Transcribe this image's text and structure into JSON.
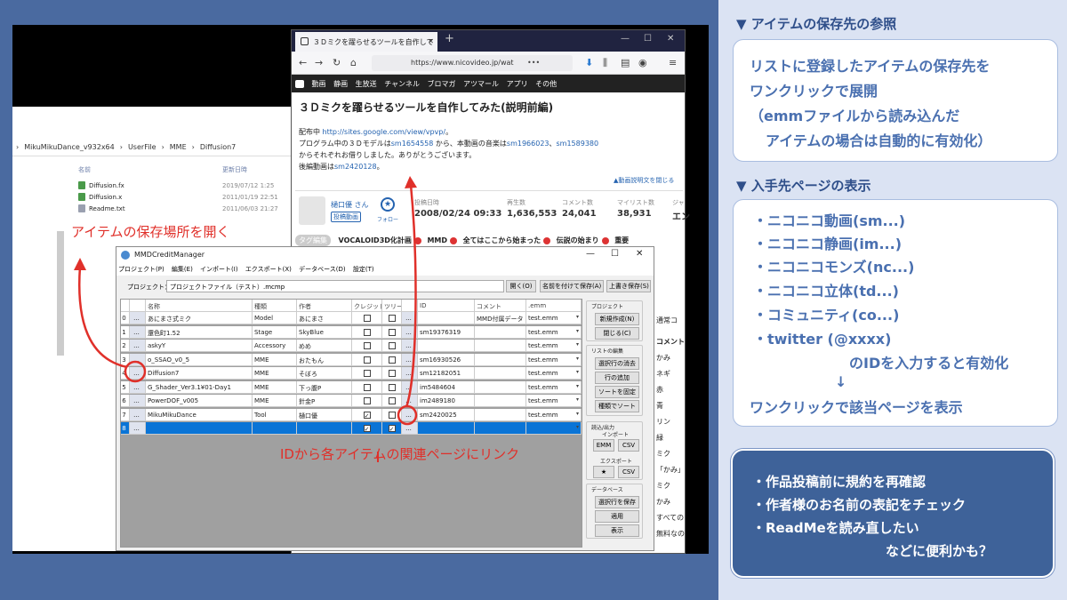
{
  "explorer": {
    "path": [
      "MikuMikuDance_v932x64",
      "UserFile",
      "MME",
      "Diffusion7"
    ],
    "col_name": "名前",
    "col_date": "更新日時",
    "files": [
      {
        "name": "Diffusion.fx",
        "date": "2019/07/12 1:25"
      },
      {
        "name": "Diffusion.x",
        "date": "2011/01/19 22:51"
      },
      {
        "name": "Readme.txt",
        "date": "2011/06/03 21:27"
      }
    ]
  },
  "annotations": {
    "open_location": "アイテムの保存場所を開く",
    "link_from_id": "IDから各アイテムの関連ページにリンク"
  },
  "browser": {
    "tab_title": "３Ｄミクを躍らせるツールを自作して",
    "tab_close": "✕",
    "new_tab": "+",
    "url": "https://www.nicovideo.jp/wat",
    "url_more": "•••",
    "nav_bar": [
      "動画",
      "静画",
      "生放送",
      "チャンネル",
      "ブロマガ",
      "アツマール",
      "アプリ",
      "その他"
    ],
    "video_title": "３Ｄミクを躍らせるツールを自作してみた(説明前編)",
    "desc": {
      "dist_label": "配布中",
      "dist_url": "http://sites.google.com/view/vpvp/",
      "dist_end": "。",
      "line2_a": "プログラム中の３Ｄモデルは",
      "sm1": "sm1654558",
      "line2_b": " から、本動画の音楽は",
      "sm2": "sm1966023",
      "line2_sep": "、",
      "sm3": "sm1589380",
      "line3": "からそれぞれお借りしました。ありがとうございます。",
      "line4_a": "後編動画は",
      "sm4": "sm2420128",
      "line4_b": "。"
    },
    "desc_toggle": "▲動画説明文を閉じる",
    "uploader_name": "樋口優 さん",
    "uploader_badge": "投稿動画",
    "follow_label": "フォロー",
    "stats": [
      {
        "label": "投稿日時",
        "value": "2008/02/24 09:33"
      },
      {
        "label": "再生数",
        "value": "1,636,553"
      },
      {
        "label": "コメント数",
        "value": "24,041"
      },
      {
        "label": "マイリスト数",
        "value": "38,931"
      },
      {
        "label": "ジャ",
        "value": "エン"
      }
    ],
    "tag_edit": "タグ編集",
    "tags": [
      "VOCALOID3D化計画",
      "MMD",
      "全てはここから始まった",
      "伝説の始まり",
      "重要"
    ],
    "side_col": [
      "通常コ",
      "コメント",
      "かみ",
      "ネギ",
      "赤",
      "青",
      "リン",
      "緑",
      "ミク",
      "「かみ」",
      "ミク",
      "かみ",
      "すべての",
      "無料なの"
    ]
  },
  "mmd": {
    "title": "MMDCreditManager",
    "menu": [
      "プロジェクト(P)",
      "編集(E)",
      "インポート(I)",
      "エクスポート(X)",
      "データベース(D)",
      "設定(T)"
    ],
    "project_label": "プロジェクト：",
    "project_value": "プロジェクトファイル（テスト）.mcmp",
    "btn_open": "開く(O)",
    "btn_save_as": "名前を付けて保存(A)",
    "btn_save": "上書き保存(S)",
    "headers": [
      "",
      "",
      "名称",
      "種類",
      "作者",
      "クレジット",
      "ツリー",
      "",
      "ID",
      "コメント",
      ".emm"
    ],
    "rows": [
      {
        "n": "0",
        "name": "あにまさ式ミク",
        "kind": "Model",
        "author": "あにまさ",
        "credit": false,
        "tree": false,
        "id": "",
        "comment": "MMD付属データ",
        "emm": "test.emm"
      },
      {
        "n": "1",
        "name": "還色町1.52",
        "kind": "Stage",
        "author": "SkyBlue",
        "credit": false,
        "tree": false,
        "id": "sm19376319",
        "comment": "",
        "emm": "test.emm"
      },
      {
        "n": "2",
        "name": "askyY",
        "kind": "Accessory",
        "author": "めめ",
        "credit": false,
        "tree": false,
        "id": "",
        "comment": "",
        "emm": "test.emm"
      },
      {
        "n": "3",
        "name": "o_SSAO_v0_5",
        "kind": "MME",
        "author": "おたもん",
        "credit": false,
        "tree": false,
        "id": "sm16930526",
        "comment": "",
        "emm": "test.emm"
      },
      {
        "n": "4",
        "name": "Diffusion7",
        "kind": "MME",
        "author": "そぼろ",
        "credit": false,
        "tree": false,
        "id": "sm12182051",
        "comment": "",
        "emm": "test.emm"
      },
      {
        "n": "5",
        "name": "G_Shader_Ver3.1¥01-Day1",
        "kind": "MME",
        "author": "下っ腹P",
        "credit": false,
        "tree": false,
        "id": "im5484604",
        "comment": "",
        "emm": "test.emm"
      },
      {
        "n": "6",
        "name": "PowerDOF_v005",
        "kind": "MME",
        "author": "針金P",
        "credit": false,
        "tree": false,
        "id": "im2489180",
        "comment": "",
        "emm": "test.emm"
      },
      {
        "n": "7",
        "name": "MikuMikuDance",
        "kind": "Tool",
        "author": "樋口優",
        "credit": true,
        "tree": false,
        "id": "sm2420025",
        "comment": "",
        "emm": "test.emm"
      },
      {
        "n": "8",
        "name": "",
        "kind": "",
        "author": "",
        "credit": true,
        "tree": true,
        "id": "",
        "comment": "",
        "emm": ""
      }
    ],
    "dots": "...",
    "grp_project": "プロジェクト",
    "btn_new": "新規作成(N)",
    "btn_close": "閉じる(C)",
    "grp_list": "リストの編集",
    "btn_del_row": "選択行の消去",
    "btn_add_row": "行の追加",
    "btn_fix_sort": "ソートを固定",
    "btn_kind_sort": "種類でソート",
    "grp_io": "読込/出力",
    "lbl_import": "インポート",
    "btn_emm": "EMM",
    "btn_csv1": "CSV",
    "lbl_export": "エクスポート",
    "btn_star": "★",
    "btn_csv2": "CSV",
    "grp_db": "データベース",
    "btn_save_sel": "選択行を保存",
    "btn_apply": "適用",
    "btn_show": "表示"
  },
  "slide": {
    "sec1_title": "▼ アイテムの保存先の参照",
    "sec1_lines": [
      "リストに登録したアイテムの保存先を",
      "ワンクリックで展開",
      "（emmファイルから読み込んだ",
      "アイテムの場合は自動的に有効化）"
    ],
    "sec2_title": "▼ 入手先ページの表示",
    "sec2_lines": [
      "・ニコニコ動画(sm...)",
      "・ニコニコ静画(im...)",
      "・ニコニコモンズ(nc...)",
      "・ニコニコ立体(td...)",
      "・コミュニティ(co...)",
      "・twitter (@xxxx)",
      "のIDを入力すると有効化",
      "↓",
      "ワンクリックで該当ページを表示"
    ],
    "tips": [
      "・作品投稿前に規約を再確認",
      "・作者様のお名前の表記をチェック",
      "・ReadMeを読み直したい",
      "などに便利かも？"
    ]
  },
  "colors": {
    "accent": "#e0302a",
    "slide_bg": "#4a6aa0",
    "panel": "#dbe3f3",
    "heading": "#2f4f8a",
    "selection": "#0a74d6"
  }
}
